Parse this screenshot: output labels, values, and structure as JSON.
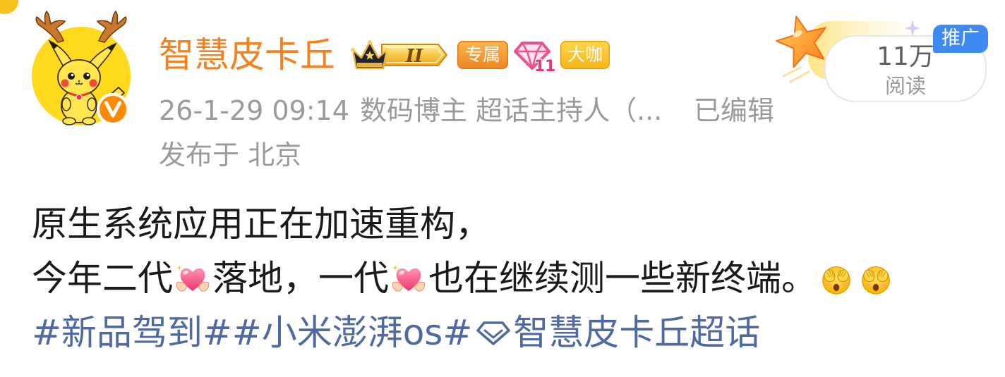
{
  "post": {
    "author": {
      "name": "智慧皮卡丘",
      "badges": {
        "crown_level": "II",
        "exclusive": "专属",
        "diamond_level": "11",
        "big_shot": "大咖"
      }
    },
    "meta": {
      "time": "26-1-29 09:14",
      "source": "数码博主 超话主持人（...",
      "edited": "已编辑",
      "location": "发布于 北京"
    },
    "stats": {
      "reads": "11万",
      "reads_label": "阅读"
    },
    "promo_tag": "推广",
    "content": {
      "line1": "原生系统应用正在加速重构，",
      "line2": [
        "今年二代",
        "落地，一代",
        "也在继续测一些新终端。"
      ]
    },
    "topics": {
      "hashtag_1": "#新品驾到#",
      "hashtag_2": "#小米澎湃os#",
      "super_topic": "智慧皮卡丘超话"
    }
  },
  "icons": {
    "avatar": "pikachu-antlers-avatar",
    "verified": "verified-v-icon",
    "crown": "crown-level-icon",
    "diamond": "pink-diamond-icon",
    "heart": "heart-hands-emoji",
    "face": "face-covering-eyes-emoji",
    "super_topic": "super-topic-diamond-icon",
    "decoration": "star-icon",
    "sparkle": "sparkle-icon"
  },
  "colors": {
    "username_orange": "#f5821f",
    "link_blue": "#4f6aa3",
    "promo_blue": "#3d8bf2",
    "meta_gray": "#9a9a9a",
    "verified_orange": "#ff8a00"
  }
}
